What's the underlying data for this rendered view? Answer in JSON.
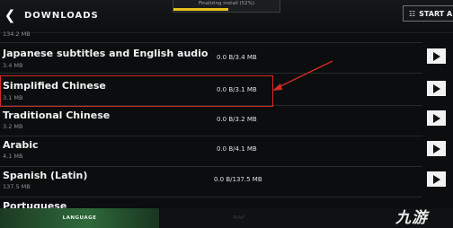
{
  "header": {
    "title": "DOWNLOADS",
    "status": "Finalizing install (52%)",
    "start_label": "START A",
    "install_progress": 0.52
  },
  "rows": [
    {
      "name": "",
      "size": "134.2 MB",
      "progress": ""
    },
    {
      "name": "Japanese subtitles and English audio",
      "size": "3.4 MB",
      "progress": "0.0 B/3.4 MB"
    },
    {
      "name": "Simplified Chinese",
      "size": "3.1 MB",
      "progress": "0.0 B/3.1 MB"
    },
    {
      "name": "Traditional Chinese",
      "size": "3.2 MB",
      "progress": "0.0 B/3.2 MB"
    },
    {
      "name": "Arabic",
      "size": "4.1 MB",
      "progress": "0.0 B/4.1 MB"
    },
    {
      "name": "Spanish (Latin)",
      "size": "137.5 MB",
      "progress": "0.0 B/137.5 MB"
    },
    {
      "name": "Portuguese",
      "size": "",
      "progress": ""
    }
  ],
  "tabs": {
    "language": "LANGUAGE",
    "map": "MAP"
  },
  "watermark": "九游",
  "colors": {
    "accent_yellow": "#e8c21c",
    "highlight_red": "#d42a28",
    "tab_green": "#2e6a3a"
  }
}
